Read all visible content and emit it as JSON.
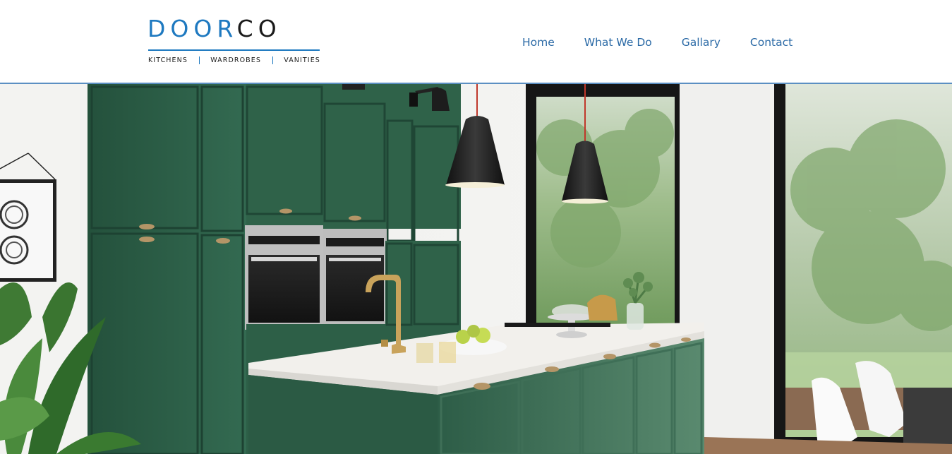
{
  "logo": {
    "word_part1": "DOOR",
    "word_part2": "CO",
    "tagline": [
      "KITCHENS",
      "WARDROBES",
      "VANITIES"
    ],
    "colors": {
      "primary": "#1e79c0",
      "secondary": "#1a1a1a"
    }
  },
  "nav": {
    "items": [
      {
        "label": "Home"
      },
      {
        "label": "What We Do"
      },
      {
        "label": "Gallary"
      },
      {
        "label": "Contact"
      }
    ],
    "link_color": "#2b6aa6"
  },
  "hero": {
    "image": "kitchen-photo",
    "cabinet_color": "#2f5e48",
    "counter_color": "#f2f0ec"
  }
}
